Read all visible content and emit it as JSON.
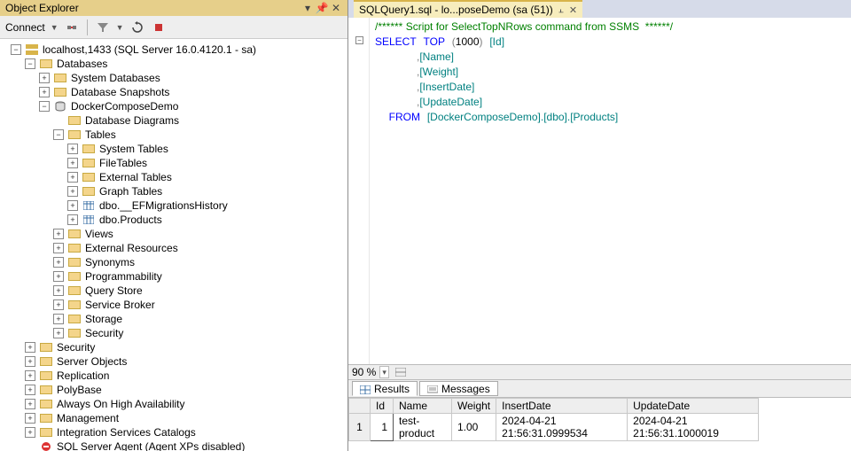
{
  "panel": {
    "title": "Object Explorer",
    "connect_label": "Connect"
  },
  "tree": {
    "server": "localhost,1433 (SQL Server 16.0.4120.1 - sa)",
    "databases": "Databases",
    "db_children": {
      "system_db": "System Databases",
      "snapshots": "Database Snapshots",
      "docker_demo": "DockerComposeDemo"
    },
    "demo_children": {
      "diagrams": "Database Diagrams",
      "tables": "Tables"
    },
    "tables_children": {
      "system": "System Tables",
      "file": "FileTables",
      "external": "External Tables",
      "graph": "Graph Tables",
      "efm": "dbo.__EFMigrationsHistory",
      "products": "dbo.Products"
    },
    "demo_rest": {
      "views": "Views",
      "ext_res": "External Resources",
      "synonyms": "Synonyms",
      "prog": "Programmability",
      "qstore": "Query Store",
      "sbroker": "Service Broker",
      "storage": "Storage",
      "security": "Security"
    },
    "server_rest": {
      "security": "Security",
      "server_objects": "Server Objects",
      "replication": "Replication",
      "polybase": "PolyBase",
      "always_on": "Always On High Availability",
      "management": "Management",
      "isc": "Integration Services Catalogs",
      "agent": "SQL Server Agent (Agent XPs disabled)"
    }
  },
  "tab_name": "SQLQuery1.sql - lo...poseDemo (sa (51))",
  "sql": {
    "comment": "/****** Script for SelectTopNRows command from SSMS  ******/",
    "kw_select": "SELECT",
    "kw_top": "TOP",
    "num_rows": "1000",
    "cols": [
      "Id",
      "Name",
      "Weight",
      "InsertDate",
      "UpdateDate"
    ],
    "kw_from": "FROM",
    "from_target": "[DockerComposeDemo].[dbo].[Products]"
  },
  "zoom": "90 %",
  "result_tabs": {
    "results": "Results",
    "messages": "Messages"
  },
  "results": {
    "headers": [
      "Id",
      "Name",
      "Weight",
      "InsertDate",
      "UpdateDate"
    ],
    "rows": [
      {
        "rownum": "1",
        "Id": "1",
        "Name": "test-product",
        "Weight": "1.00",
        "InsertDate": "2024-04-21 21:56:31.0999534",
        "UpdateDate": "2024-04-21 21:56:31.1000019"
      }
    ]
  }
}
